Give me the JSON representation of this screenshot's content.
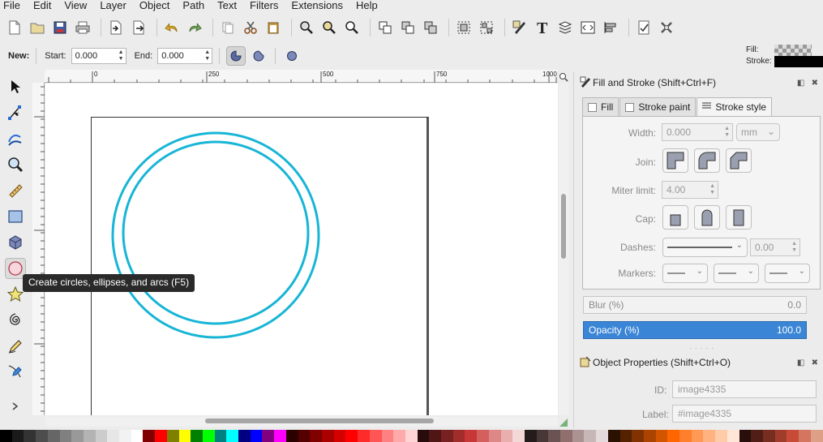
{
  "menu": [
    "File",
    "Edit",
    "View",
    "Layer",
    "Object",
    "Path",
    "Text",
    "Filters",
    "Extensions",
    "Help"
  ],
  "indicator": {
    "fill_label": "Fill:",
    "stroke_label": "Stroke:"
  },
  "tool_controls": {
    "new_label": "New:",
    "start_label": "Start:",
    "start_value": "0.000",
    "end_label": "End:",
    "end_value": "0.000"
  },
  "ruler_ticks": [
    "0",
    "250",
    "500",
    "750",
    "1000"
  ],
  "tooltip": "Create circles, ellipses, and arcs (F5)",
  "fill_stroke": {
    "title": "Fill and Stroke (Shift+Ctrl+F)",
    "tabs": [
      "Fill",
      "Stroke paint",
      "Stroke style"
    ],
    "width_label": "Width:",
    "width_value": "0.000",
    "unit": "mm",
    "join_label": "Join:",
    "miter_label": "Miter limit:",
    "miter_value": "4.00",
    "cap_label": "Cap:",
    "dashes_label": "Dashes:",
    "dash_offset": "0.00",
    "markers_label": "Markers:",
    "blur_label": "Blur (%)",
    "blur_value": "0.0",
    "opacity_label": "Opacity (%)",
    "opacity_value": "100.0"
  },
  "object_props": {
    "title": "Object Properties (Shift+Ctrl+O)",
    "id_label": "ID:",
    "id_value": "image4335",
    "label_label": "Label:",
    "label_value": "#image4335"
  },
  "colors": {
    "circle_stroke": "#17b5d6",
    "opacity_bar": "#3a85d6"
  },
  "palette": [
    "#000000",
    "#1a1a1a",
    "#333333",
    "#4d4d4d",
    "#666666",
    "#808080",
    "#999999",
    "#b3b3b3",
    "#cccccc",
    "#e6e6e6",
    "#f2f2f2",
    "#ffffff",
    "#800000",
    "#ff0000",
    "#808000",
    "#ffff00",
    "#008000",
    "#00ff00",
    "#008080",
    "#00ffff",
    "#000080",
    "#0000ff",
    "#800080",
    "#ff00ff",
    "#2b0000",
    "#550000",
    "#800000",
    "#aa0000",
    "#d40000",
    "#ff0000",
    "#ff2a2a",
    "#ff5555",
    "#ff8080",
    "#ffaaaa",
    "#ffd5d5",
    "#280b0b",
    "#501616",
    "#782121",
    "#a02c2c",
    "#c83737",
    "#d35f5f",
    "#de8787",
    "#e9afaf",
    "#f4d7d7",
    "#241c1c",
    "#483737",
    "#6c5353",
    "#916f6f",
    "#ac9393",
    "#c8b7b7",
    "#e3dbdb",
    "#2b1100",
    "#552200",
    "#803300",
    "#aa4400",
    "#d45500",
    "#ff6600",
    "#ff7f2a",
    "#ff9955",
    "#ffb380",
    "#ffccaa",
    "#ffe6d5",
    "#280f0b",
    "#501e16",
    "#782d21",
    "#a03c2c",
    "#c84b37",
    "#d3755f",
    "#de9f87"
  ]
}
